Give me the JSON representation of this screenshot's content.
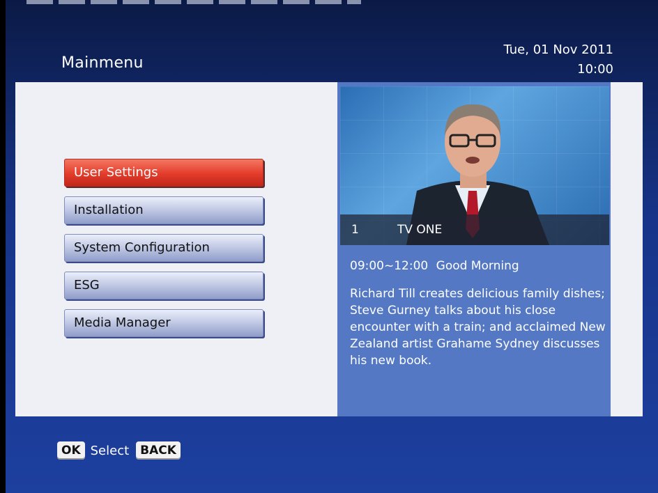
{
  "header": {
    "title": "Mainmenu",
    "date": "Tue, 01 Nov 2011",
    "time": "10:00"
  },
  "menu": {
    "items": [
      {
        "label": "User Settings",
        "selected": true
      },
      {
        "label": "Installation"
      },
      {
        "label": "System Configuration"
      },
      {
        "label": "ESG"
      },
      {
        "label": "Media Manager"
      }
    ]
  },
  "preview": {
    "channel_number": "1",
    "channel_name": "TV ONE"
  },
  "program": {
    "time": "09:00~12:00",
    "title": "Good Morning",
    "description": "Richard Till creates delicious family dishes; Steve Gurney talks about his close encounter with a train; and acclaimed New Zealand artist Grahame Sydney discusses his new book."
  },
  "footer": {
    "ok_key": "OK",
    "select_label": "Select",
    "back_key": "BACK"
  },
  "colors": {
    "accent_selected": "#e33b2a",
    "header_blue": "#17348a",
    "info_panel": "#5478c3"
  }
}
